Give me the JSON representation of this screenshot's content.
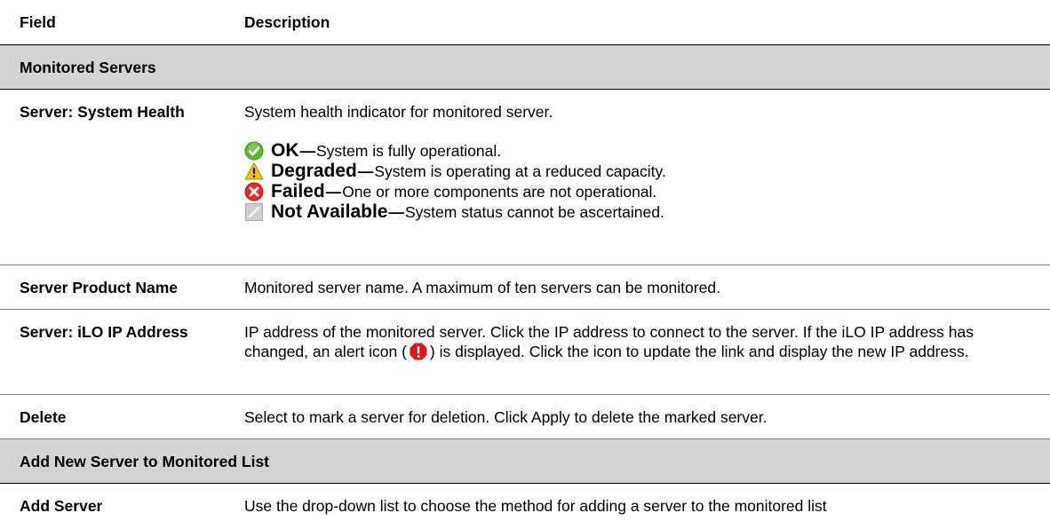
{
  "header": {
    "field": "Field",
    "description": "Description"
  },
  "sections": {
    "monitored": "Monitored Servers",
    "add_new": "Add New Server to Monitored List"
  },
  "rows": {
    "system_health": {
      "field": "Server: System Health",
      "intro": "System health indicator for monitored server.",
      "states": [
        {
          "name": "OK",
          "dash": "—",
          "text": "System is fully operational.",
          "icon": "ok-check-icon",
          "color": "#5cb832"
        },
        {
          "name": "Degraded",
          "dash": "—",
          "text": "System is operating at a reduced capacity.",
          "icon": "warning-triangle-icon",
          "color": "#f4c20d"
        },
        {
          "name": "Failed",
          "dash": "—",
          "text": "One or more components are not operational.",
          "icon": "failed-x-icon",
          "color": "#e02d2d"
        },
        {
          "name": "Not Available",
          "dash": "—",
          "text": "System status cannot be ascertained.",
          "icon": "not-available-icon",
          "color": "#c8c8c8"
        }
      ]
    },
    "product_name": {
      "field": "Server Product Name",
      "desc": "Monitored server name. A maximum of ten servers can be monitored."
    },
    "ilo_ip": {
      "field": "Server: iLO IP Address",
      "desc_before": "IP address of the monitored server. Click the IP address to connect to the server. If the iLO IP address has changed, an alert icon (",
      "desc_after": ") is displayed. Click the icon to update the link and display the new IP address."
    },
    "delete": {
      "field": "Delete",
      "desc": "Select to mark a server for deletion. Click Apply to delete the marked server."
    },
    "add_server": {
      "field": "Add Server",
      "desc": "Use the drop-down list to choose the method for adding a server to the monitored list"
    }
  }
}
